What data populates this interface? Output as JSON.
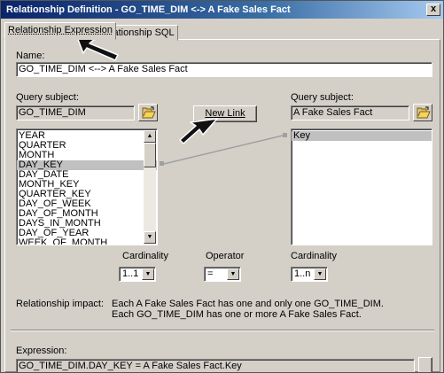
{
  "window": {
    "title": "Relationship Definition - GO_TIME_DIM <-> A Fake Sales Fact",
    "close_glyph": "x"
  },
  "tabs": [
    {
      "label": "Relationship Expression",
      "active": true
    },
    {
      "label": "Relationship SQL",
      "active": false
    }
  ],
  "name": {
    "label": "Name:",
    "value": "GO_TIME_DIM <--> A Fake Sales Fact"
  },
  "left_subject": {
    "label": "Query subject:",
    "value": "GO_TIME_DIM",
    "items": [
      "YEAR",
      "QUARTER",
      "MONTH",
      "DAY_KEY",
      "DAY_DATE",
      "MONTH_KEY",
      "QUARTER_KEY",
      "DAY_OF_WEEK",
      "DAY_OF_MONTH",
      "DAYS_IN_MONTH",
      "DAY_OF_YEAR",
      "WEEK_OF_MONTH"
    ],
    "selected": "DAY_KEY"
  },
  "right_subject": {
    "label": "Query subject:",
    "value": "A Fake Sales Fact",
    "items": [
      "Key"
    ],
    "selected": "Key"
  },
  "new_link_label": "New Link",
  "cardinality_left": {
    "label": "Cardinality",
    "value": "1..1"
  },
  "operator": {
    "label": "Operator",
    "value": "="
  },
  "cardinality_right": {
    "label": "Cardinality",
    "value": "1..n"
  },
  "impact": {
    "label": "Relationship impact:",
    "line1": "Each A Fake Sales Fact has one and only one GO_TIME_DIM.",
    "line2": "Each GO_TIME_DIM has one or more A Fake Sales Fact."
  },
  "expression": {
    "label": "Expression:",
    "value": "GO_TIME_DIM.DAY_KEY = A Fake Sales Fact.Key"
  },
  "icons": {
    "folder": "folder-open-icon",
    "scroll_up": "scroll-up-arrow-icon",
    "scroll_down": "scroll-down-arrow-icon",
    "dropdown": "chevron-down-icon",
    "pointer": "pointer-arrow-icon"
  },
  "colors": {
    "titlebar_start": "#0a246a",
    "titlebar_end": "#a6caf0",
    "dialog_face": "#d4d0c8",
    "selection": "#c0c0c0",
    "link_line": "#a0a0a0"
  }
}
